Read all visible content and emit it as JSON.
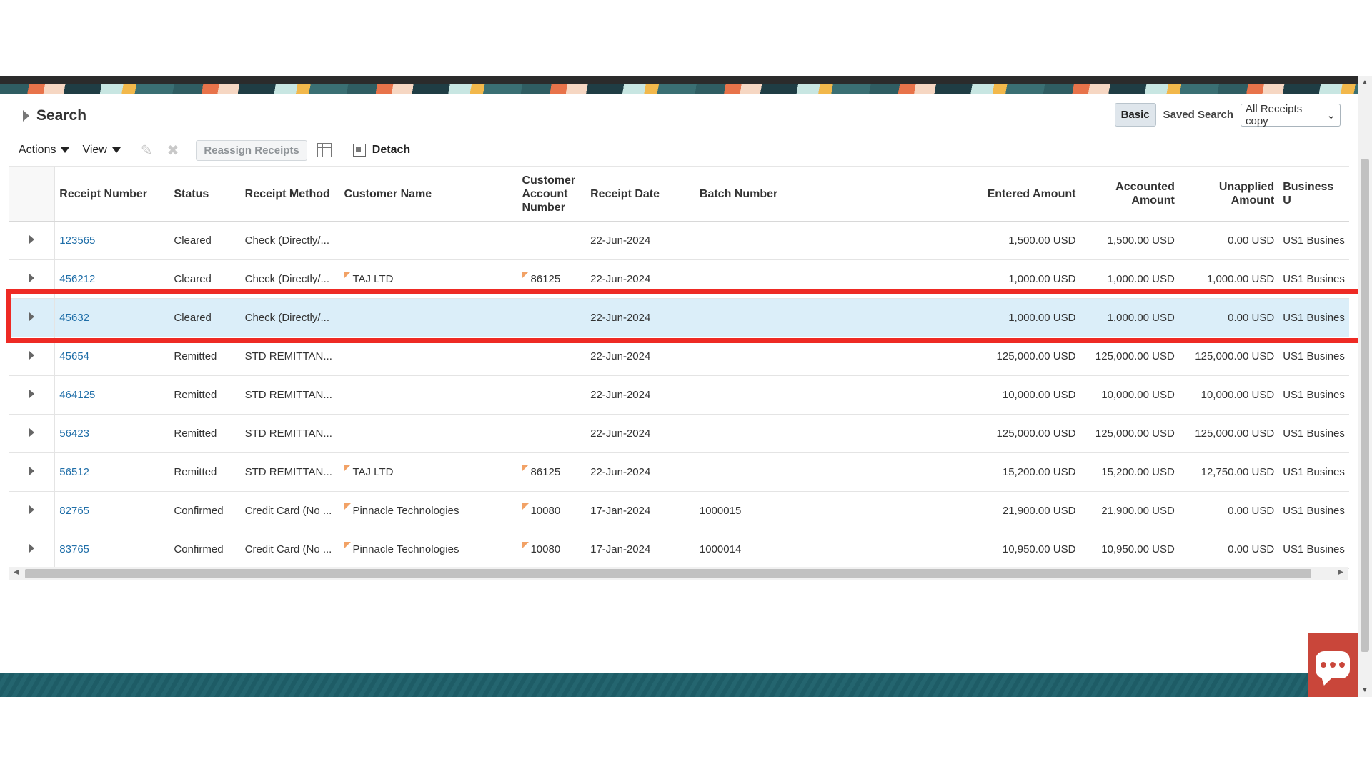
{
  "search": {
    "title": "Search",
    "basic_label": "Basic",
    "saved_search_label": "Saved Search",
    "saved_search_value": "All Receipts copy"
  },
  "toolbar": {
    "actions_label": "Actions",
    "view_label": "View",
    "reassign_label": "Reassign Receipts",
    "detach_label": "Detach"
  },
  "table": {
    "headers": {
      "receipt_number": "Receipt Number",
      "status": "Status",
      "receipt_method": "Receipt Method",
      "customer_name": "Customer Name",
      "customer_account_number": "Customer Account Number",
      "receipt_date": "Receipt Date",
      "batch_number": "Batch Number",
      "entered_amount": "Entered Amount",
      "accounted_amount": "Accounted Amount",
      "unapplied_amount": "Unapplied Amount",
      "business_unit": "Business U"
    },
    "rows": [
      {
        "receipt_number": "123565",
        "status": "Cleared",
        "receipt_method": "Check (Directly/...",
        "customer_name": "",
        "customer_account_number": "",
        "receipt_date": "22-Jun-2024",
        "batch_number": "",
        "entered_amount": "1,500.00 USD",
        "accounted_amount": "1,500.00 USD",
        "unapplied_amount": "0.00 USD",
        "business_unit": "US1 Busines"
      },
      {
        "receipt_number": "456212",
        "status": "Cleared",
        "receipt_method": "Check (Directly/...",
        "customer_name": "TAJ LTD",
        "customer_account_number": "86125",
        "receipt_date": "22-Jun-2024",
        "batch_number": "",
        "entered_amount": "1,000.00 USD",
        "accounted_amount": "1,000.00 USD",
        "unapplied_amount": "1,000.00 USD",
        "business_unit": "US1 Busines"
      },
      {
        "receipt_number": "45632",
        "status": "Cleared",
        "receipt_method": "Check (Directly/...",
        "customer_name": "",
        "customer_account_number": "",
        "receipt_date": "22-Jun-2024",
        "batch_number": "",
        "entered_amount": "1,000.00 USD",
        "accounted_amount": "1,000.00 USD",
        "unapplied_amount": "0.00 USD",
        "business_unit": "US1 Busines"
      },
      {
        "receipt_number": "45654",
        "status": "Remitted",
        "receipt_method": "STD REMITTAN...",
        "customer_name": "",
        "customer_account_number": "",
        "receipt_date": "22-Jun-2024",
        "batch_number": "",
        "entered_amount": "125,000.00 USD",
        "accounted_amount": "125,000.00 USD",
        "unapplied_amount": "125,000.00 USD",
        "business_unit": "US1 Busines"
      },
      {
        "receipt_number": "464125",
        "status": "Remitted",
        "receipt_method": "STD REMITTAN...",
        "customer_name": "",
        "customer_account_number": "",
        "receipt_date": "22-Jun-2024",
        "batch_number": "",
        "entered_amount": "10,000.00 USD",
        "accounted_amount": "10,000.00 USD",
        "unapplied_amount": "10,000.00 USD",
        "business_unit": "US1 Busines"
      },
      {
        "receipt_number": "56423",
        "status": "Remitted",
        "receipt_method": "STD REMITTAN...",
        "customer_name": "",
        "customer_account_number": "",
        "receipt_date": "22-Jun-2024",
        "batch_number": "",
        "entered_amount": "125,000.00 USD",
        "accounted_amount": "125,000.00 USD",
        "unapplied_amount": "125,000.00 USD",
        "business_unit": "US1 Busines"
      },
      {
        "receipt_number": "56512",
        "status": "Remitted",
        "receipt_method": "STD REMITTAN...",
        "customer_name": "TAJ LTD",
        "customer_account_number": "86125",
        "receipt_date": "22-Jun-2024",
        "batch_number": "",
        "entered_amount": "15,200.00 USD",
        "accounted_amount": "15,200.00 USD",
        "unapplied_amount": "12,750.00 USD",
        "business_unit": "US1 Busines"
      },
      {
        "receipt_number": "82765",
        "status": "Confirmed",
        "receipt_method": "Credit Card (No ...",
        "customer_name": "Pinnacle Technologies",
        "customer_account_number": "10080",
        "receipt_date": "17-Jan-2024",
        "batch_number": "1000015",
        "entered_amount": "21,900.00 USD",
        "accounted_amount": "21,900.00 USD",
        "unapplied_amount": "0.00 USD",
        "business_unit": "US1 Busines"
      },
      {
        "receipt_number": "83765",
        "status": "Confirmed",
        "receipt_method": "Credit Card (No ...",
        "customer_name": "Pinnacle Technologies",
        "customer_account_number": "10080",
        "receipt_date": "17-Jan-2024",
        "batch_number": "1000014",
        "entered_amount": "10,950.00 USD",
        "accounted_amount": "10,950.00 USD",
        "unapplied_amount": "0.00 USD",
        "business_unit": "US1 Busines"
      }
    ],
    "selected_row": 2
  },
  "colors": {
    "link": "#1f6ea8",
    "selected_row": "#dbeef9",
    "highlight": "#ee2a24",
    "chat": "#c9463a",
    "flag": "#f2a266"
  },
  "icons": {
    "expand": "triangle-right-icon",
    "edit": "pencil-icon",
    "delete": "x-icon",
    "columns": "freeze-columns-icon",
    "detach": "detach-icon",
    "chat": "chat-bubble-icon"
  }
}
